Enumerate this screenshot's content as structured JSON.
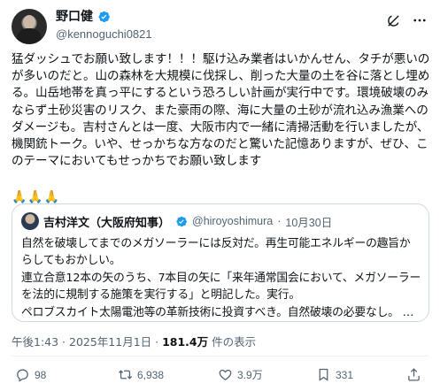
{
  "author": {
    "display_name": "野口健",
    "handle": "@kennoguchi0821"
  },
  "header_icons": [
    "grok-icon",
    "more-icon"
  ],
  "tweet": {
    "text": "猛ダッシュでお願い致します！！！駆け込み業者はいかんせん、タチが悪いのが多いのだと。山の森林を大規模に伐採し、削った大量の土を谷に落とし埋める。山岳地帯を真っ平にするという恐ろしい計画が実行中です。環境破壊のみならず土砂災害のリスク、また豪雨の際、海に大量の土砂が流れ込み漁業へのダメージも。吉村さんとは一度、大阪市内で一緒に清掃活動を行いましたが、機関銃トーク。いや、せっかちな方なのだと驚いた記憶ありますが、ぜひ、このテーマにおいてもせっかちでお願い致します",
    "emoji": "🙏🙏🙏"
  },
  "quote": {
    "display_name": "吉村洋文（大阪府知事）",
    "handle": "@hiroyoshimura",
    "separator": "·",
    "date": "10月30日",
    "text": "自然を破壊してまでのメガソーラーには反対だ。再生可能エネルギーの趣旨からしてもおかしい。\n連立合意12本の矢のうち、7本目の矢に「来年通常国会において、メガソーラーを法的に規制する施策を実行する」と明記した。実行。\nペロブスカイト太陽電池等の革新技術に投資すべき。自然破壊の必要なし。 …"
  },
  "meta": {
    "time": "午後1:43 · 2025年11月1日 · ",
    "views_count": "181.4万",
    "views_label": " 件の表示"
  },
  "actions": {
    "reply": "98",
    "retweet": "6,938",
    "like": "3.9万",
    "bookmark": "331"
  },
  "colors": {
    "verified": "#1d9bf0",
    "muted": "#536471",
    "border": "#cfd9de"
  }
}
